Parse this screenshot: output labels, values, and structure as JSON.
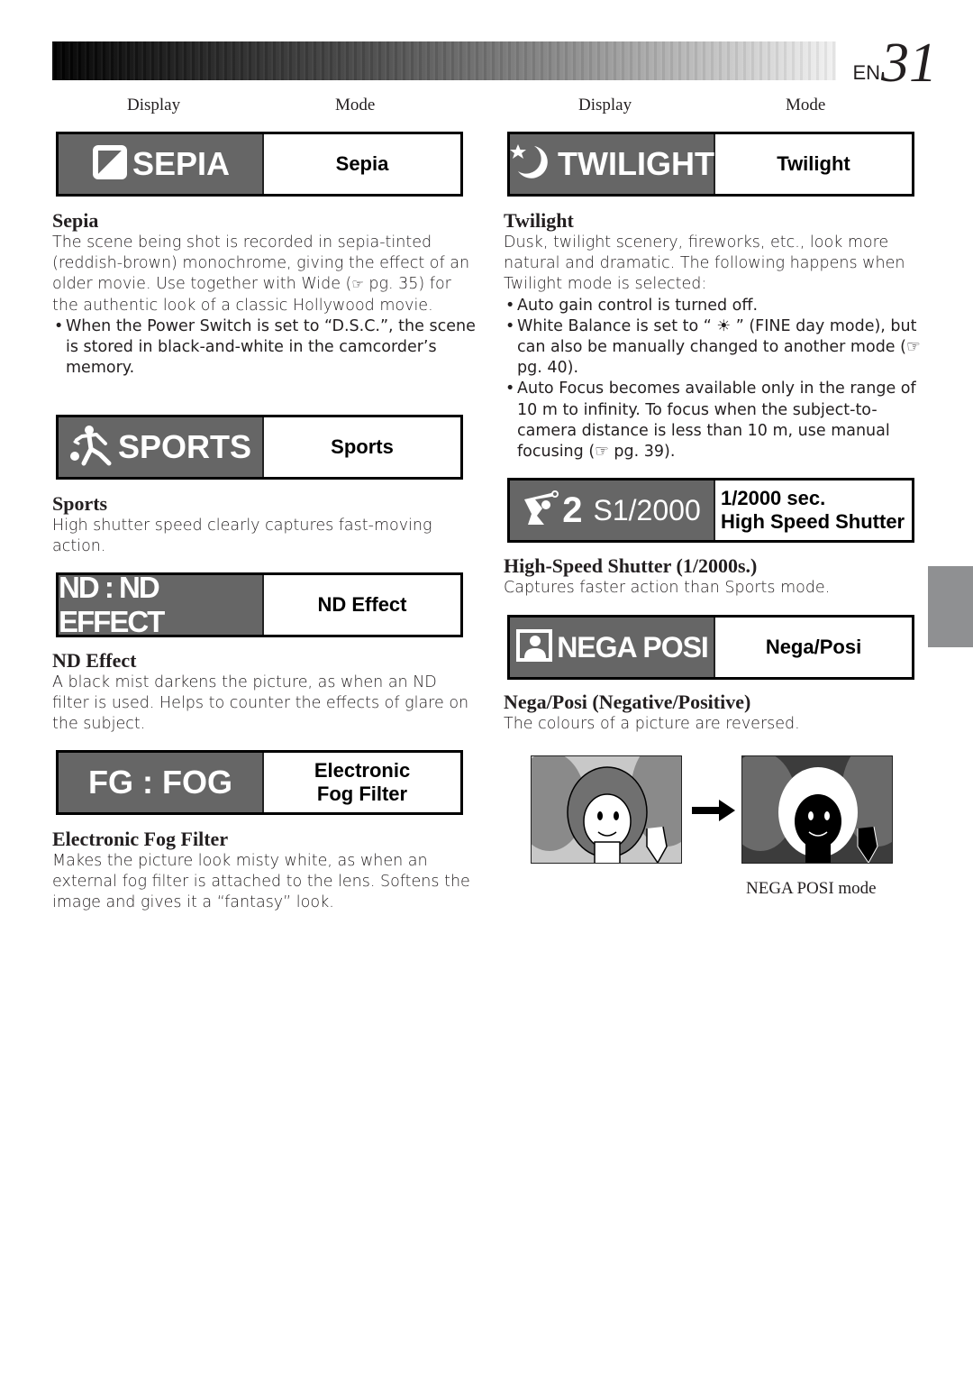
{
  "header": {
    "prefix": "EN",
    "page_number": "31"
  },
  "column_headers": {
    "left": {
      "display": "Display",
      "mode": "Mode"
    },
    "right": {
      "display": "Display",
      "mode": "Mode"
    }
  },
  "modes": {
    "sepia": {
      "display_label": "SEPIA",
      "icon": "sepia-square-icon",
      "mode_label": "Sepia",
      "title": "Sepia",
      "body": "The scene being shot is recorded in sepia-tinted (reddish-brown) monochrome, giving the effect of an older movie. Use together with Wide (",
      "body_ref": "☞",
      "body_after": " pg. 35) for the authentic look of a classic Hollywood movie.",
      "bullets": [
        "When the Power Switch is set to “D.S.C.”, the scene is stored in black-and-white in the camcorder’s memory."
      ]
    },
    "sports": {
      "display_label": "SPORTS",
      "icon": "sports-runner-icon",
      "mode_label": "Sports",
      "title": "Sports",
      "body": "High shutter speed clearly captures fast-moving action."
    },
    "nd": {
      "display_label": "ND : ND EFFECT",
      "mode_label": "ND Effect",
      "title": "ND Effect",
      "body": "A black mist darkens the picture, as when an ND filter is used. Helps to counter the effects of glare on the subject."
    },
    "fog": {
      "display_label": "FG : FOG",
      "mode_label_line1": "Electronic",
      "mode_label_line2": "Fog Filter",
      "title": "Electronic Fog Filter",
      "body": "Makes the picture look misty white, as when an external fog filter is attached to the lens. Softens the image and gives it a “fantasy” look."
    },
    "twilight": {
      "display_label": "TWILIGHT",
      "icon": "moon-star-icon",
      "mode_label": "Twilight",
      "title": "Twilight",
      "body": "Dusk, twilight scenery, fireworks, etc., look more natural and dramatic. The following happens when Twilight mode is selected:",
      "bullet1": "Auto gain control is turned off.",
      "bullet2_pre": "White Balance is set to “ ",
      "bullet2_icon": "☀",
      "bullet2_post": " ” (FINE day mode), but can also be manually changed to another mode (☞ pg. 40).",
      "bullet3": "Auto Focus becomes available only in the range of 10 m to infinity. To focus when the subject-to-camera distance is less than 10 m, use manual focusing (☞ pg. 39)."
    },
    "shutter": {
      "display_label_num": "2",
      "display_label": "S1/2000",
      "icon": "golfer-icon",
      "mode_label_line1": "1/2000 sec.",
      "mode_label_line2": "High Speed Shutter",
      "title": "High-Speed Shutter (1/2000s.)",
      "body": "Captures faster action than Sports mode."
    },
    "negaposi": {
      "display_label": "NEGA POSI",
      "icon": "portrait-icon",
      "mode_label": "Nega/Posi",
      "title": "Nega/Posi (Negative/Positive)",
      "body": "The colours of a picture are reversed.",
      "caption": "NEGA POSI mode"
    }
  }
}
